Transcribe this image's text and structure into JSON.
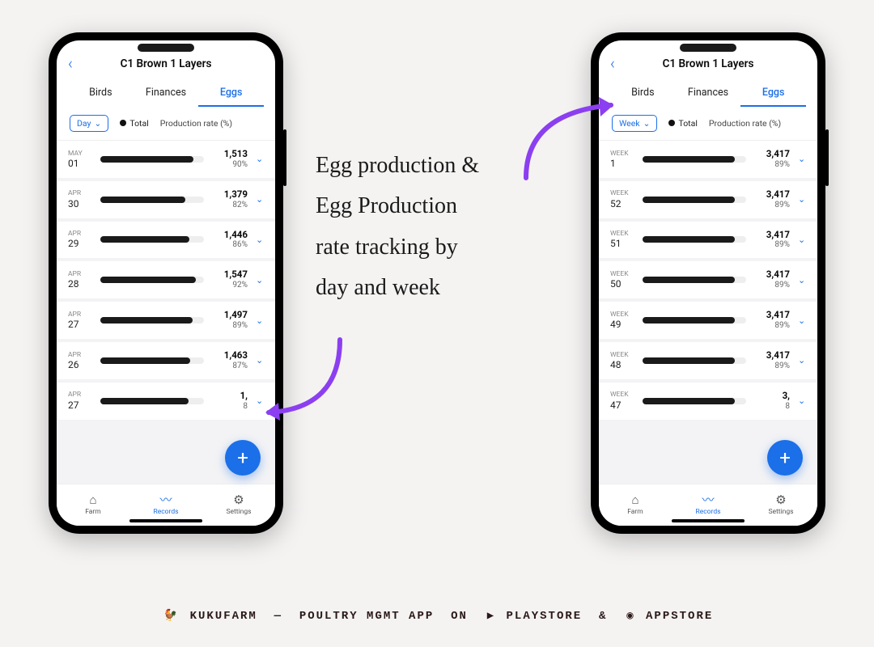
{
  "header": {
    "title": "C1 Brown 1 Layers"
  },
  "tabs": {
    "birds": "Birds",
    "finances": "Finances",
    "eggs": "Eggs"
  },
  "filter": {
    "range_day": "Day",
    "range_week": "Week",
    "legend_total": "Total",
    "rate_label": "Production rate (%)"
  },
  "nav": {
    "farm": "Farm",
    "records": "Records",
    "settings": "Settings"
  },
  "phone_left": {
    "rows": [
      {
        "m": "MAY",
        "d": "01",
        "total": "1,513",
        "pct": "90%",
        "bar": 90
      },
      {
        "m": "APR",
        "d": "30",
        "total": "1,379",
        "pct": "82%",
        "bar": 82
      },
      {
        "m": "APR",
        "d": "29",
        "total": "1,446",
        "pct": "86%",
        "bar": 86
      },
      {
        "m": "APR",
        "d": "28",
        "total": "1,547",
        "pct": "92%",
        "bar": 92
      },
      {
        "m": "APR",
        "d": "27",
        "total": "1,497",
        "pct": "89%",
        "bar": 89
      },
      {
        "m": "APR",
        "d": "26",
        "total": "1,463",
        "pct": "87%",
        "bar": 87
      },
      {
        "m": "APR",
        "d": "27",
        "total": "1,",
        "pct": "8",
        "bar": 85
      }
    ]
  },
  "phone_right": {
    "rows": [
      {
        "m": "WEEK",
        "d": "1",
        "total": "3,417",
        "pct": "89%",
        "bar": 89
      },
      {
        "m": "WEEK",
        "d": "52",
        "total": "3,417",
        "pct": "89%",
        "bar": 89
      },
      {
        "m": "WEEK",
        "d": "51",
        "total": "3,417",
        "pct": "89%",
        "bar": 89
      },
      {
        "m": "WEEK",
        "d": "50",
        "total": "3,417",
        "pct": "89%",
        "bar": 89
      },
      {
        "m": "WEEK",
        "d": "49",
        "total": "3,417",
        "pct": "89%",
        "bar": 89
      },
      {
        "m": "WEEK",
        "d": "48",
        "total": "3,417",
        "pct": "89%",
        "bar": 89
      },
      {
        "m": "WEEK",
        "d": "47",
        "total": "3,",
        "pct": "8",
        "bar": 89
      }
    ]
  },
  "annotation": {
    "line1": "Egg production &",
    "line2": "Egg Production",
    "line3": "rate tracking by",
    "line4": "day and week"
  },
  "footer": {
    "brand": "KUKUFARM",
    "tagline": "POULTRY MGMT APP",
    "on": "ON",
    "playstore": "PLAYSTORE",
    "and": "&",
    "appstore": "APPSTORE"
  },
  "colors": {
    "accent": "#1b6fe8",
    "arrow": "#8b3ff0"
  }
}
